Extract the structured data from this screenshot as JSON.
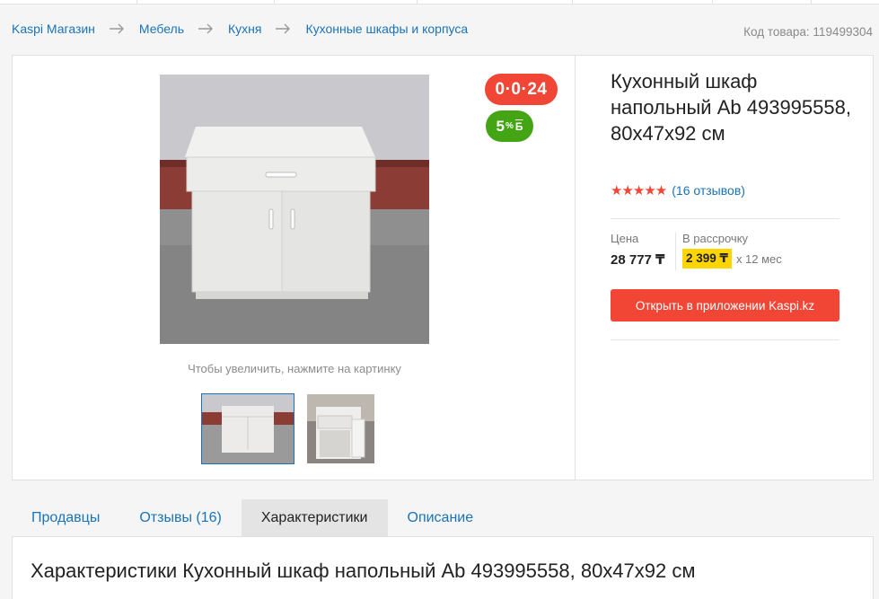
{
  "breadcrumbs": [
    "Kaspi Магазин",
    "Мебель",
    "Кухня",
    "Кухонные шкафы и корпуса"
  ],
  "product_code": "Код товара: 119499304",
  "gallery": {
    "zoom_hint": "Чтобы увеличить, нажмите на картинку"
  },
  "badges": {
    "installment": "0·0·24",
    "bonus_value": "5",
    "bonus_percent": "%",
    "bonus_currency": "Б"
  },
  "product": {
    "title": "Кухонный шкаф напольный Ab 493995558, 80x47x92 см",
    "stars": "★★★★★",
    "rating_value": 5,
    "reviews": "(16 отзывов)"
  },
  "price": {
    "label": "Цена",
    "value": "28 777 ₸",
    "installment_label": "В рассрочку",
    "installment_amount": "2 399 ₸",
    "installment_term": "x 12 мес"
  },
  "open_button": "Открыть в приложении Kaspi.kz",
  "tabs": [
    {
      "label": "Продавцы"
    },
    {
      "label": "Отзывы (16)"
    },
    {
      "label": "Характеристики",
      "active": true
    },
    {
      "label": "Описание"
    }
  ],
  "specs": {
    "title": "Характеристики Кухонный шкаф напольный Ab 493995558, 80x47x92 см"
  },
  "colors": {
    "link": "#1a73b8",
    "accent_red": "#f14635",
    "bonus_green": "#43a513",
    "highlight_yellow": "#ffd500"
  }
}
